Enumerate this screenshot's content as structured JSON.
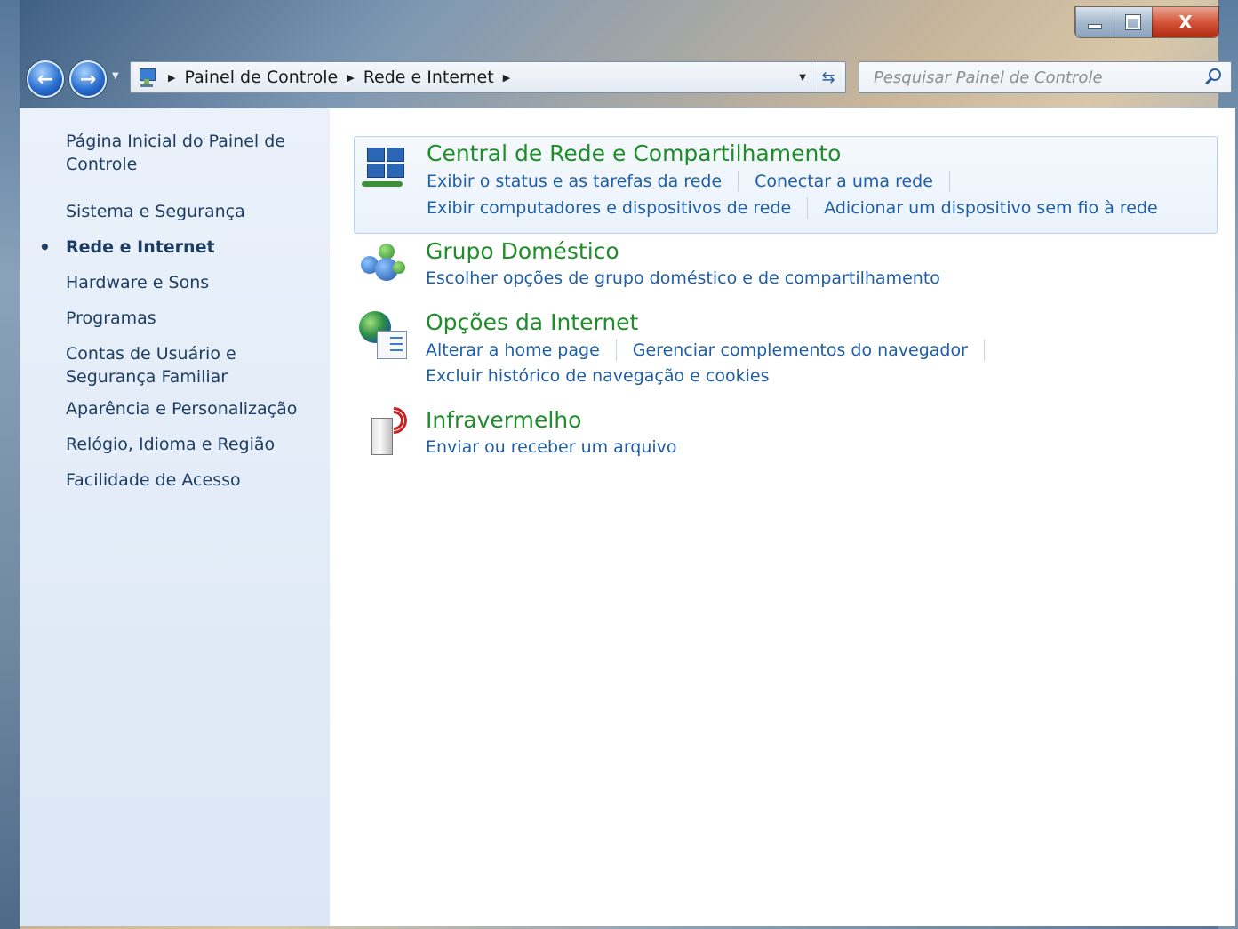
{
  "window": {
    "controls": {
      "minimize": "minimize",
      "maximize": "maximize",
      "close": "X"
    }
  },
  "navigation": {
    "back_icon": "arrow-left-icon",
    "forward_icon": "arrow-right-icon"
  },
  "address": {
    "crumbs": [
      "Painel de Controle",
      "Rede e Internet"
    ]
  },
  "search": {
    "placeholder": "Pesquisar Painel de Controle"
  },
  "sidebar": {
    "items": [
      {
        "label": "Página Inicial do Painel de Controle",
        "active": false
      },
      {
        "label": "Sistema e Segurança",
        "active": false
      },
      {
        "label": "Rede e Internet",
        "active": true
      },
      {
        "label": "Hardware e Sons",
        "active": false
      },
      {
        "label": "Programas",
        "active": false
      },
      {
        "label": "Contas de Usuário e Segurança Familiar",
        "active": false
      },
      {
        "label": "Aparência e Personalização",
        "active": false
      },
      {
        "label": "Relógio, Idioma e Região",
        "active": false
      },
      {
        "label": "Facilidade de Acesso",
        "active": false
      }
    ]
  },
  "categories": [
    {
      "title": "Central de Rede e Compartilhamento",
      "icon": "network-computers-icon",
      "rows": [
        [
          "Exibir o status e as tarefas da rede",
          "Conectar a uma rede"
        ],
        [
          "Exibir computadores e dispositivos de rede",
          "Adicionar um dispositivo sem fio à rede"
        ]
      ]
    },
    {
      "title": "Grupo Doméstico",
      "icon": "homegroup-icon",
      "rows": [
        [
          "Escolher opções de grupo doméstico e de compartilhamento"
        ]
      ]
    },
    {
      "title": "Opções da Internet",
      "icon": "internet-options-icon",
      "rows": [
        [
          "Alterar a home page",
          "Gerenciar complementos do navegador"
        ],
        [
          "Excluir histórico de navegação e cookies"
        ]
      ]
    },
    {
      "title": "Infravermelho",
      "icon": "infrared-icon",
      "rows": [
        [
          "Enviar ou receber um arquivo"
        ]
      ]
    }
  ],
  "colors": {
    "category_title": "#1f8d2a",
    "link": "#1f5fa8",
    "sidebar_text": "#1e3d63",
    "sidebar_bg": "#dbe7f5"
  }
}
